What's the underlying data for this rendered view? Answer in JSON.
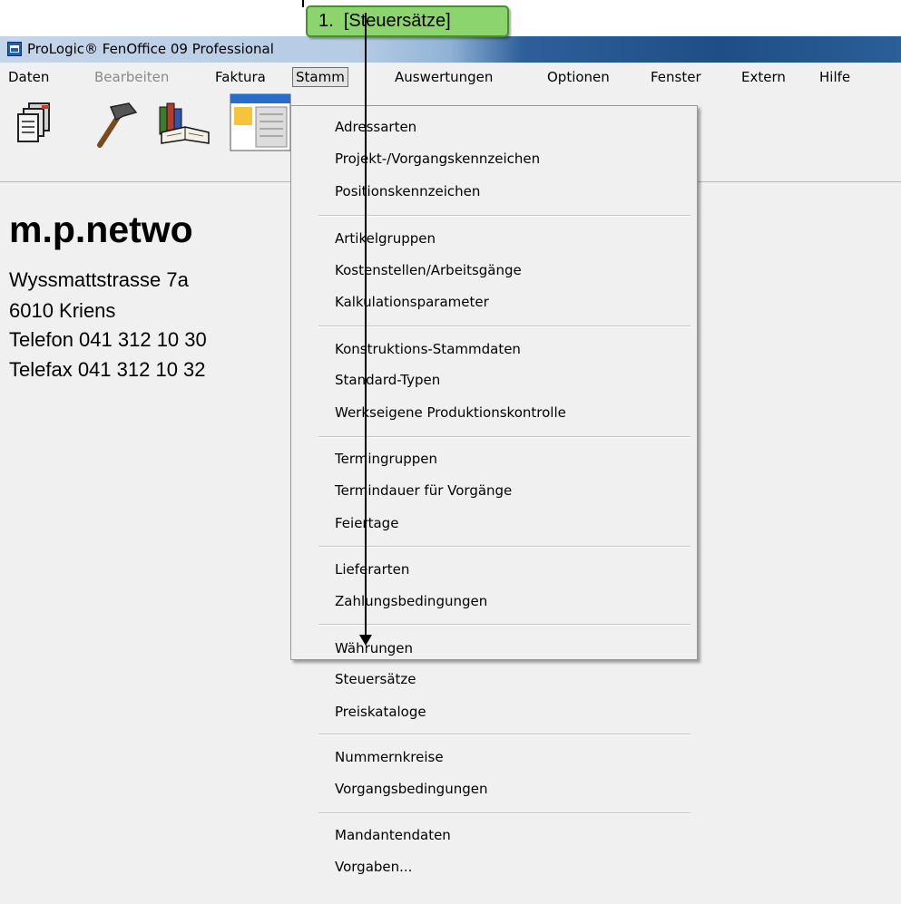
{
  "window": {
    "title": "ProLogic® FenOffice 09 Professional"
  },
  "menubar": {
    "items": [
      {
        "label": "Daten",
        "state": "normal"
      },
      {
        "label": "Bearbeiten",
        "state": "disabled"
      },
      {
        "label": "Faktura",
        "state": "normal"
      },
      {
        "label": "Stamm",
        "state": "open"
      },
      {
        "label": "Auswertungen",
        "state": "normal"
      },
      {
        "label": "Optionen",
        "state": "normal"
      },
      {
        "label": "Fenster",
        "state": "normal"
      },
      {
        "label": "Extern",
        "state": "normal"
      },
      {
        "label": "Hilfe",
        "state": "normal"
      }
    ]
  },
  "toolbar": {
    "icons": [
      "documents-icon",
      "hammer-icon",
      "books-icon",
      "window-list-icon"
    ]
  },
  "company": {
    "name": "m.p.netwo",
    "street": "Wyssmattstrasse 7a",
    "city": "6010 Kriens",
    "phone": "Telefon 041 312 10 30",
    "fax": "Telefax 041 312 10 32"
  },
  "stamm_menu": {
    "groups": [
      [
        "Adressarten",
        "Projekt-/Vorgangskennzeichen",
        "Positionskennzeichen"
      ],
      [
        "Artikelgruppen",
        "Kostenstellen/Arbeitsgänge",
        "Kalkulationsparameter"
      ],
      [
        "Konstruktions-Stammdaten",
        "Standard-Typen",
        "Werkseigene Produktionskontrolle"
      ],
      [
        "Termingruppen",
        "Termindauer für Vorgänge",
        "Feiertage"
      ],
      [
        "Lieferarten",
        "Zahlungsbedingungen"
      ],
      [
        "Währungen",
        "Steuersätze",
        "Preiskataloge"
      ],
      [
        "Nummernkreise",
        "Vorgangsbedingungen"
      ],
      [
        "Mandantendaten",
        "Vorgaben..."
      ]
    ]
  },
  "annotation": {
    "step": "1.",
    "label": "[Steuersätze]",
    "color": "#8cd46e"
  }
}
